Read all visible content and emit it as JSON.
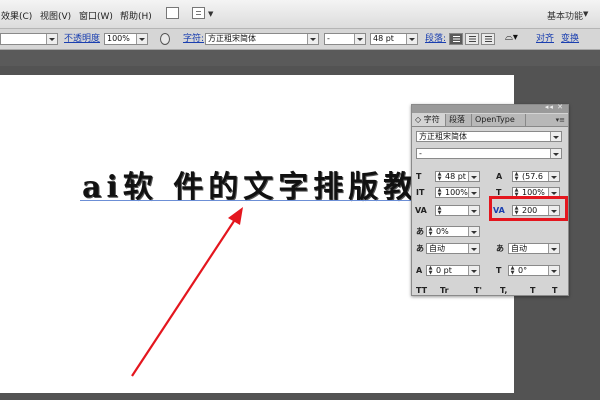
{
  "menu": {
    "items": [
      "效果(C)",
      "视图(V)",
      "窗口(W)",
      "帮助(H)"
    ],
    "workspace": "基本功能"
  },
  "control": {
    "opacity_label": "不透明度",
    "opacity_value": "100%",
    "char_label": "字符:",
    "font_family": "方正粗宋简体",
    "font_style": "-",
    "font_size": "48 pt",
    "para_label": "段落:",
    "align_label": "对齐",
    "transform_label": "变换"
  },
  "canvas": {
    "text": "ai软 件的文字排版教"
  },
  "char_panel": {
    "tabs": [
      "字符",
      "段落",
      "OpenType"
    ],
    "font_family": "方正粗宋简体",
    "font_style": "-",
    "font_size": "48 pt",
    "leading": "(57.6",
    "vert_scale": "100%",
    "horiz_scale": "100%",
    "kerning": "",
    "tracking": "200",
    "baseline_shift_pct": "0%",
    "mojikumi": "自动",
    "tsume": "自动",
    "insert_space": "0 pt",
    "rotation": "0°",
    "label_size": "T",
    "label_leading": "A",
    "label_vscale": "IT",
    "label_hscale": "T",
    "label_kern": "VA",
    "label_track": "VA",
    "label_shift": "あ",
    "label_aki1": "あ",
    "label_aki2": "あ",
    "label_space": "A",
    "label_rotate": "T",
    "bottom_icons": [
      "TT",
      "Tr",
      "T'",
      "T,",
      "T",
      "T"
    ]
  },
  "colors": {
    "highlight": "#e4161e",
    "arrow": "#e4161e"
  }
}
